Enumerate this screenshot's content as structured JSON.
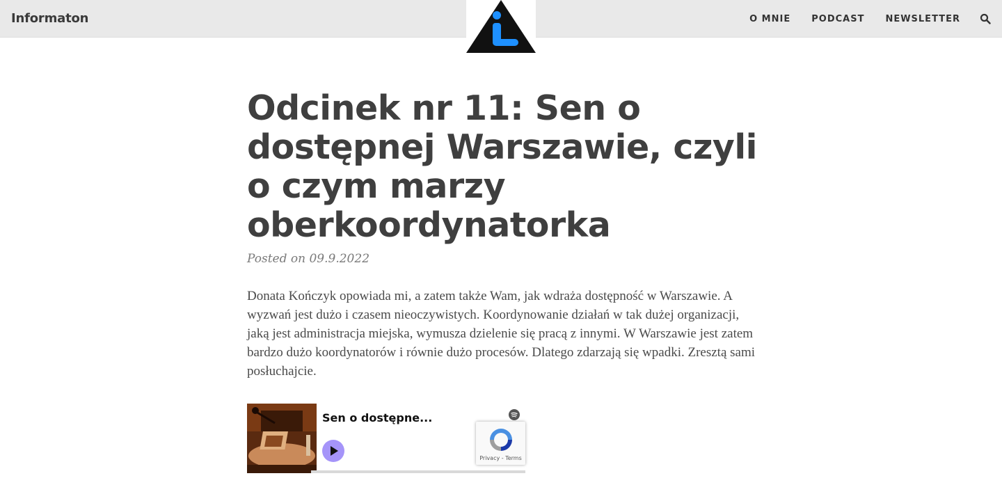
{
  "header": {
    "site_title": "Informaton",
    "nav": [
      "O MNIE",
      "PODCAST",
      "NEWSLETTER"
    ],
    "search_icon": "search-icon",
    "logo_icon": "info-triangle-icon"
  },
  "article": {
    "title": "Odcinek nr 11: Sen o dostępnej Warszawie, czyli o czym marzy oberkoordynatorka",
    "posted_label": "Posted on",
    "date": "09.9.2022",
    "body": "Donata Kończyk opowiada mi, a zatem także Wam, jak wdraża dostępność w Warszawie. A wyzwań jest dużo i czasem nieoczywistych. Koordynowanie działań w tak dużej organizacji, jaką jest administracja miejska, wymusza dzielenie się pracą z innymi. W Warszawie jest zatem bardzo dużo koordynatorów i równie dużo procesów. Dlatego zdarzają się wpadki. Zresztą sami posłuchajcie."
  },
  "embed": {
    "episode_title": "Sen o dostępne...",
    "player_icon": "spotify-icon",
    "play_icon": "play-icon",
    "accent_color": "#a594f9"
  },
  "recaptcha": {
    "privacy": "Privacy",
    "separator": "-",
    "terms": "Terms"
  },
  "colors": {
    "topbar": "#e9e9e9",
    "logo_blue": "#1e90ff",
    "text": "#404040"
  }
}
